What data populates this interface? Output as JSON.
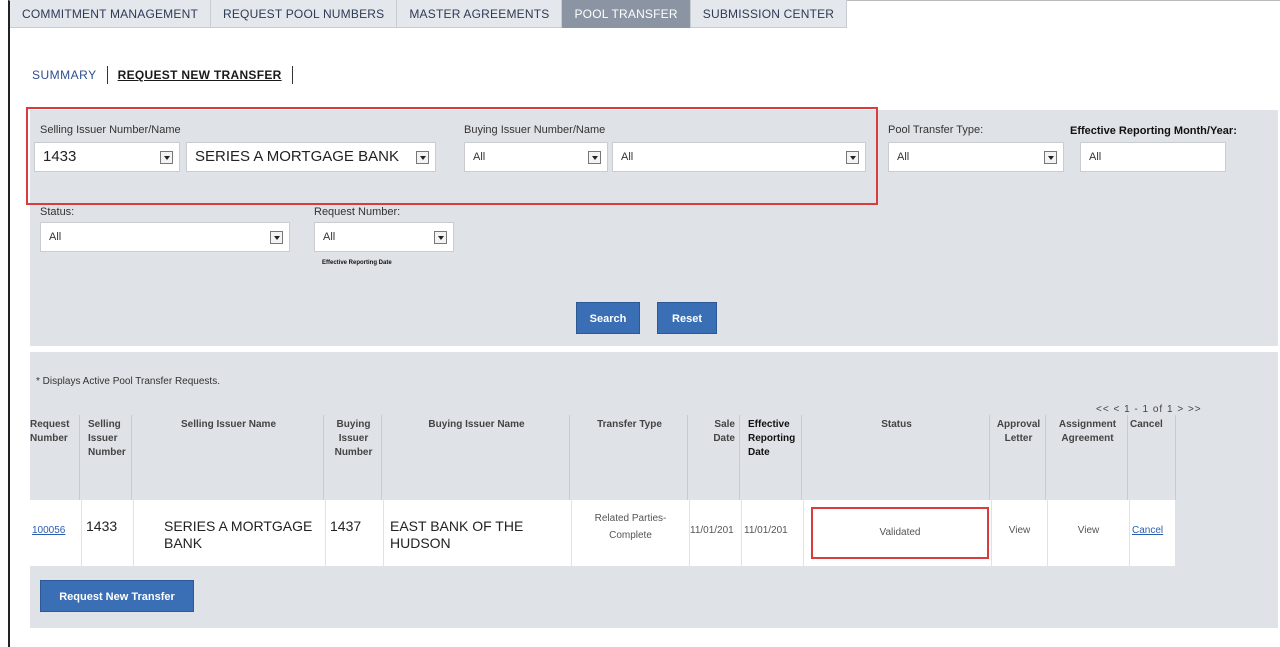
{
  "tabs": [
    "COMMITMENT MANAGEMENT",
    "REQUEST POOL NUMBERS",
    "MASTER AGREEMENTS",
    "POOL TRANSFER",
    "SUBMISSION CENTER"
  ],
  "subnav": {
    "summary": "SUMMARY",
    "request_new": "REQUEST NEW TRANSFER"
  },
  "filters": {
    "selling_label": "Selling Issuer Number/Name",
    "selling_number": "1433",
    "selling_name": "SERIES A MORTGAGE BANK",
    "buying_label": "Buying Issuer Number/Name",
    "buying_number": "All",
    "buying_name": "All",
    "pool_type_label": "Pool Transfer Type:",
    "pool_type": "All",
    "eff_label": "Effective Reporting Month/Year:",
    "eff_value": "All",
    "status_label": "Status:",
    "status": "All",
    "request_label": "Request Number:",
    "request": "All",
    "eff_date_label": "Effective Reporting Date",
    "search": "Search",
    "reset": "Reset"
  },
  "results": {
    "note": "* Displays Active Pool Transfer Requests.",
    "pager": "<<   <   1 - 1 of 1   >   >>",
    "headers": {
      "request": "Request Number",
      "sell_num": "Selling Issuer Number",
      "sell_name": "Selling Issuer Name",
      "buy_num": "Buying Issuer Number",
      "buy_name": "Buying Issuer Name",
      "type": "Transfer Type",
      "sale": "Sale Date",
      "eff": "Effective Reporting Date",
      "status": "Status",
      "approval": "Approval Letter",
      "assign": "Assignment Agreement",
      "cancel": "Cancel"
    },
    "row": {
      "request": "100056",
      "sell_num": "1433",
      "sell_name": "SERIES A MORTGAGE BANK",
      "buy_num": "1437",
      "buy_name": "EAST BANK OF THE HUDSON",
      "type": "Related Parties- Complete",
      "sale": "11/01/201",
      "eff": "11/01/201",
      "status": "Validated",
      "approval": "View",
      "assign": "View",
      "cancel": "Cancel"
    },
    "request_new_button": "Request New Transfer"
  }
}
